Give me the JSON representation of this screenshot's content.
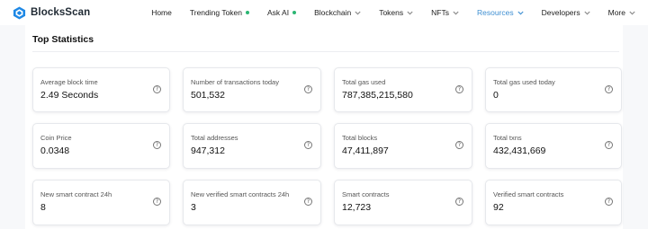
{
  "brand": {
    "name": "BlocksScan",
    "color": "#1e88e5"
  },
  "nav": {
    "items": [
      {
        "label": "Home",
        "indicator": "none",
        "active": false
      },
      {
        "label": "Trending Token",
        "indicator": "green-dot",
        "active": false
      },
      {
        "label": "Ask AI",
        "indicator": "green-dot",
        "active": false
      },
      {
        "label": "Blockchain",
        "indicator": "chevron-down-icon",
        "active": false
      },
      {
        "label": "Tokens",
        "indicator": "chevron-down-icon",
        "active": false
      },
      {
        "label": "NFTs",
        "indicator": "chevron-down-icon",
        "active": false
      },
      {
        "label": "Resources",
        "indicator": "chevron-down-icon",
        "active": true
      },
      {
        "label": "Developers",
        "indicator": "chevron-down-icon",
        "active": false
      },
      {
        "label": "More",
        "indicator": "chevron-down-icon",
        "active": false
      }
    ]
  },
  "main": {
    "title": "Top Statistics",
    "stats": [
      {
        "label": "Average block time",
        "value": "2.49 Seconds"
      },
      {
        "label": "Number of transactions today",
        "value": "501,532"
      },
      {
        "label": "Total gas used",
        "value": "787,385,215,580"
      },
      {
        "label": "Total gas used today",
        "value": "0"
      },
      {
        "label": "Coin Price",
        "value": "0.0348"
      },
      {
        "label": "Total addresses",
        "value": "947,312"
      },
      {
        "label": "Total blocks",
        "value": "47,411,897"
      },
      {
        "label": "Total txns",
        "value": "432,431,669"
      },
      {
        "label": "New smart contract 24h",
        "value": "8"
      },
      {
        "label": "New verified smart contracts 24h",
        "value": "3"
      },
      {
        "label": "Smart contracts",
        "value": "12,723"
      },
      {
        "label": "Verified smart contracts",
        "value": "92"
      }
    ],
    "help_icon": "question-circle-icon",
    "help_glyph": "?"
  },
  "colors": {
    "accent": "#3f8fd2",
    "status_dot": "#2bb673",
    "page_bg": "#f7f8fa"
  }
}
